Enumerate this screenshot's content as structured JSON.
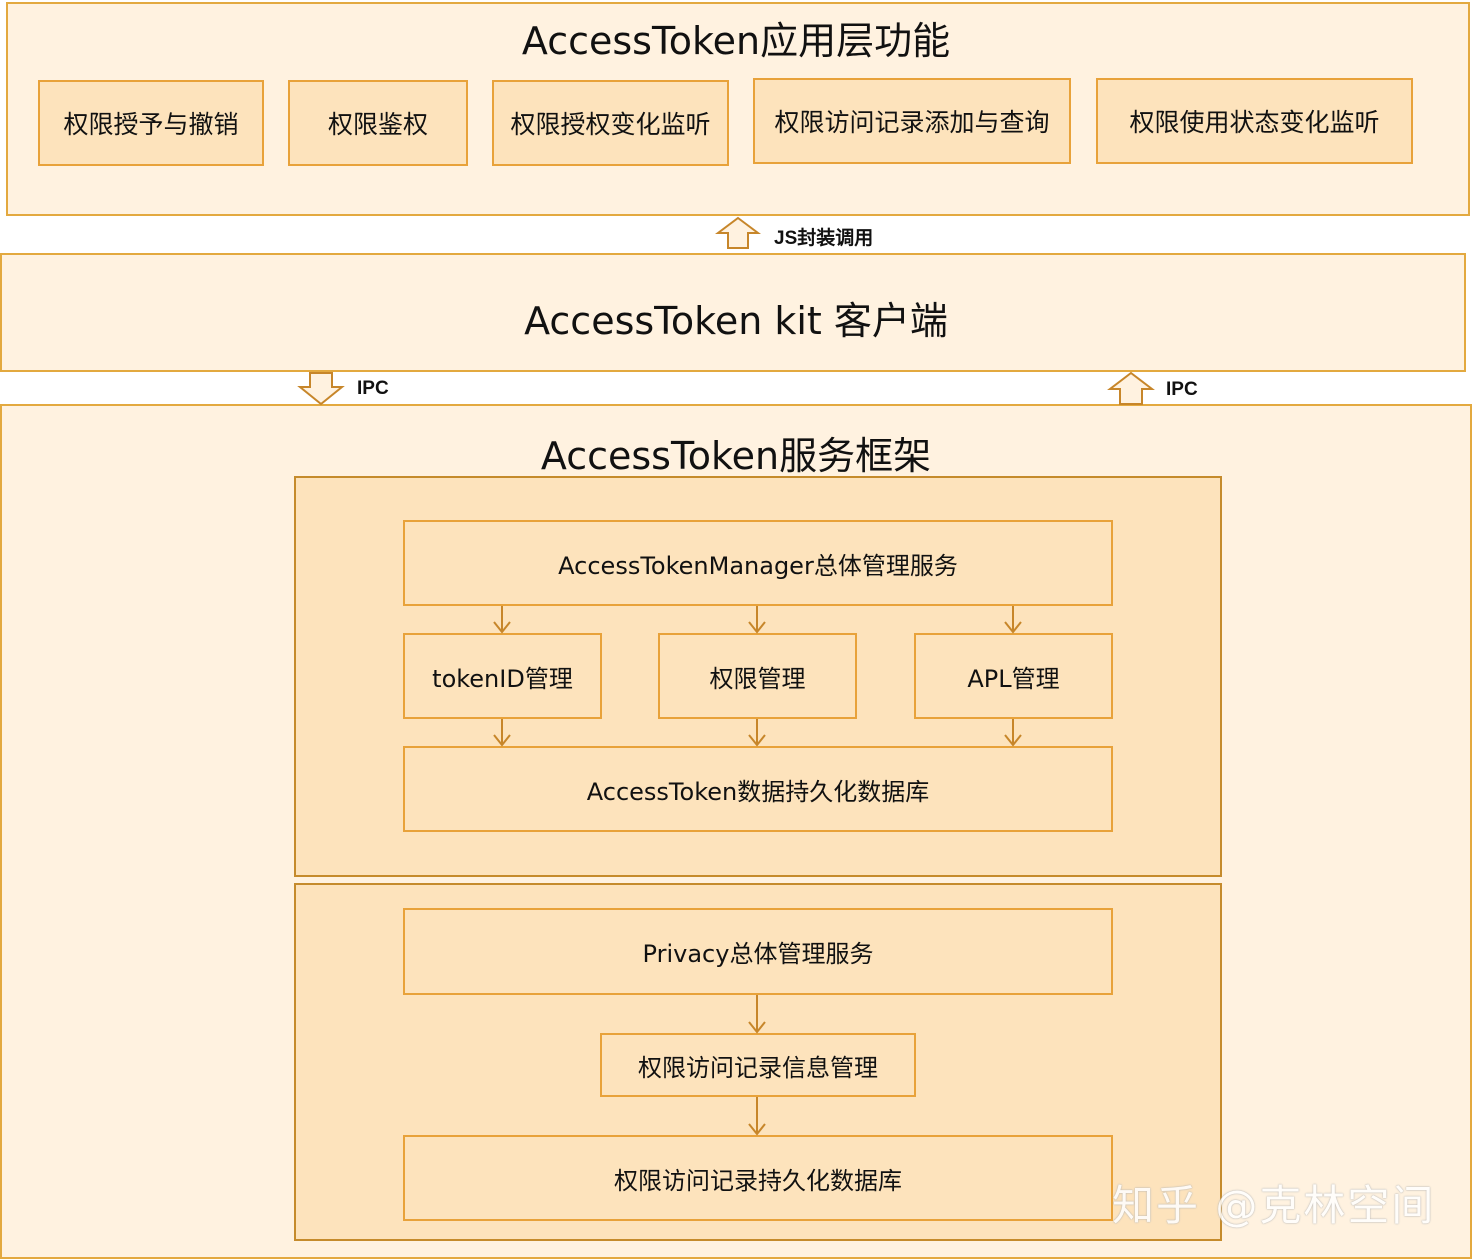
{
  "app_layer": {
    "title": "AccessToken应用层功能",
    "items": [
      "权限授予与撤销",
      "权限鉴权",
      "权限授权变化监听",
      "权限访问记录添加与查询",
      "权限使用状态变化监听"
    ]
  },
  "js_call_label": "JS封装调用",
  "kit_layer": {
    "title": "AccessToken kit 客户端"
  },
  "ipc_left_label": "IPC",
  "ipc_right_label": "IPC",
  "service_layer": {
    "title": "AccessToken服务框架",
    "accesstoken_group": {
      "manager": "AccessTokenManager总体管理服务",
      "modules": [
        "tokenID管理",
        "权限管理",
        "APL管理"
      ],
      "database": "AccessToken数据持久化数据库"
    },
    "privacy_group": {
      "manager": "Privacy总体管理服务",
      "record_info": "权限访问记录信息管理",
      "database": "权限访问记录持久化数据库"
    }
  },
  "watermark": "知乎 @克林空间",
  "colors": {
    "layer_fill": "#fff2e0",
    "node_fill": "#fde3bc",
    "border": "#e1a53d",
    "arrow": "#c7862a"
  }
}
